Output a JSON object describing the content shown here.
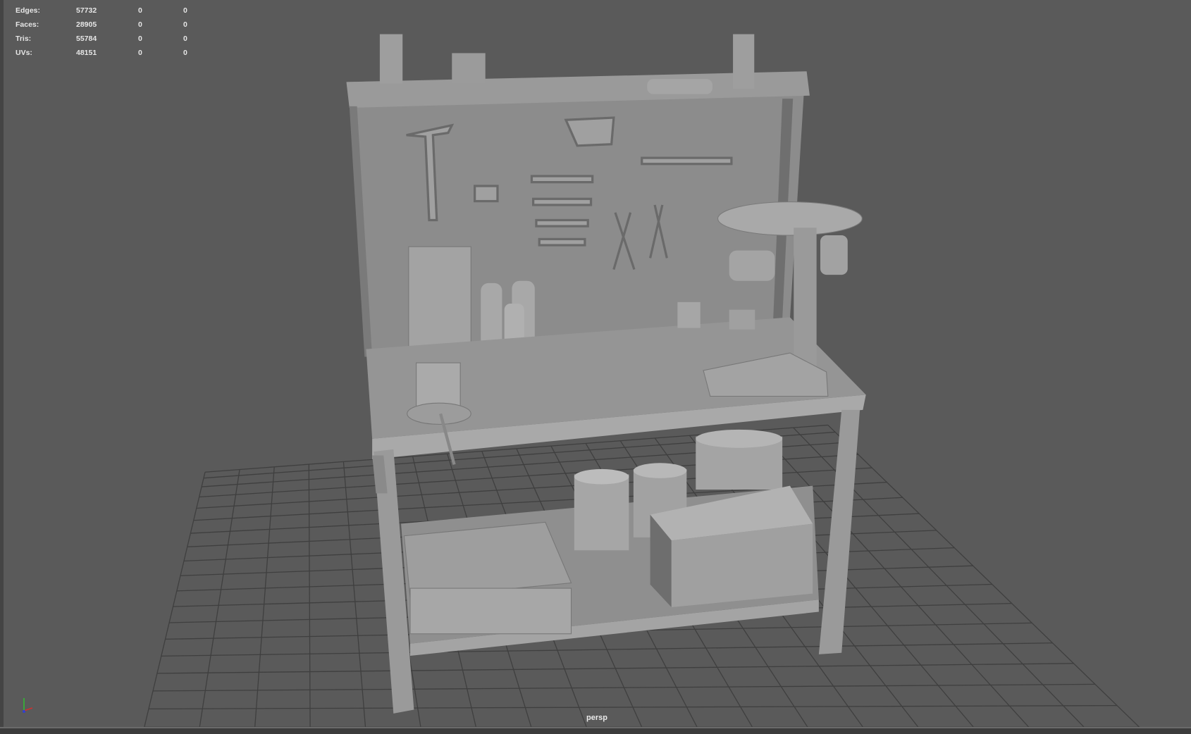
{
  "hud": {
    "rows": [
      {
        "label": "Edges:",
        "value": "57732",
        "sel": "0",
        "extra": "0"
      },
      {
        "label": "Faces:",
        "value": "28905",
        "sel": "0",
        "extra": "0"
      },
      {
        "label": "Tris:",
        "value": "55784",
        "sel": "0",
        "extra": "0"
      },
      {
        "label": "UVs:",
        "value": "48151",
        "sel": "0",
        "extra": "0"
      }
    ]
  },
  "camera": {
    "name": "persp"
  },
  "axis": {
    "x": "x",
    "y": "y",
    "z": "z",
    "x_color": "#d03030",
    "y_color": "#30c030",
    "z_color": "#3040d0"
  }
}
